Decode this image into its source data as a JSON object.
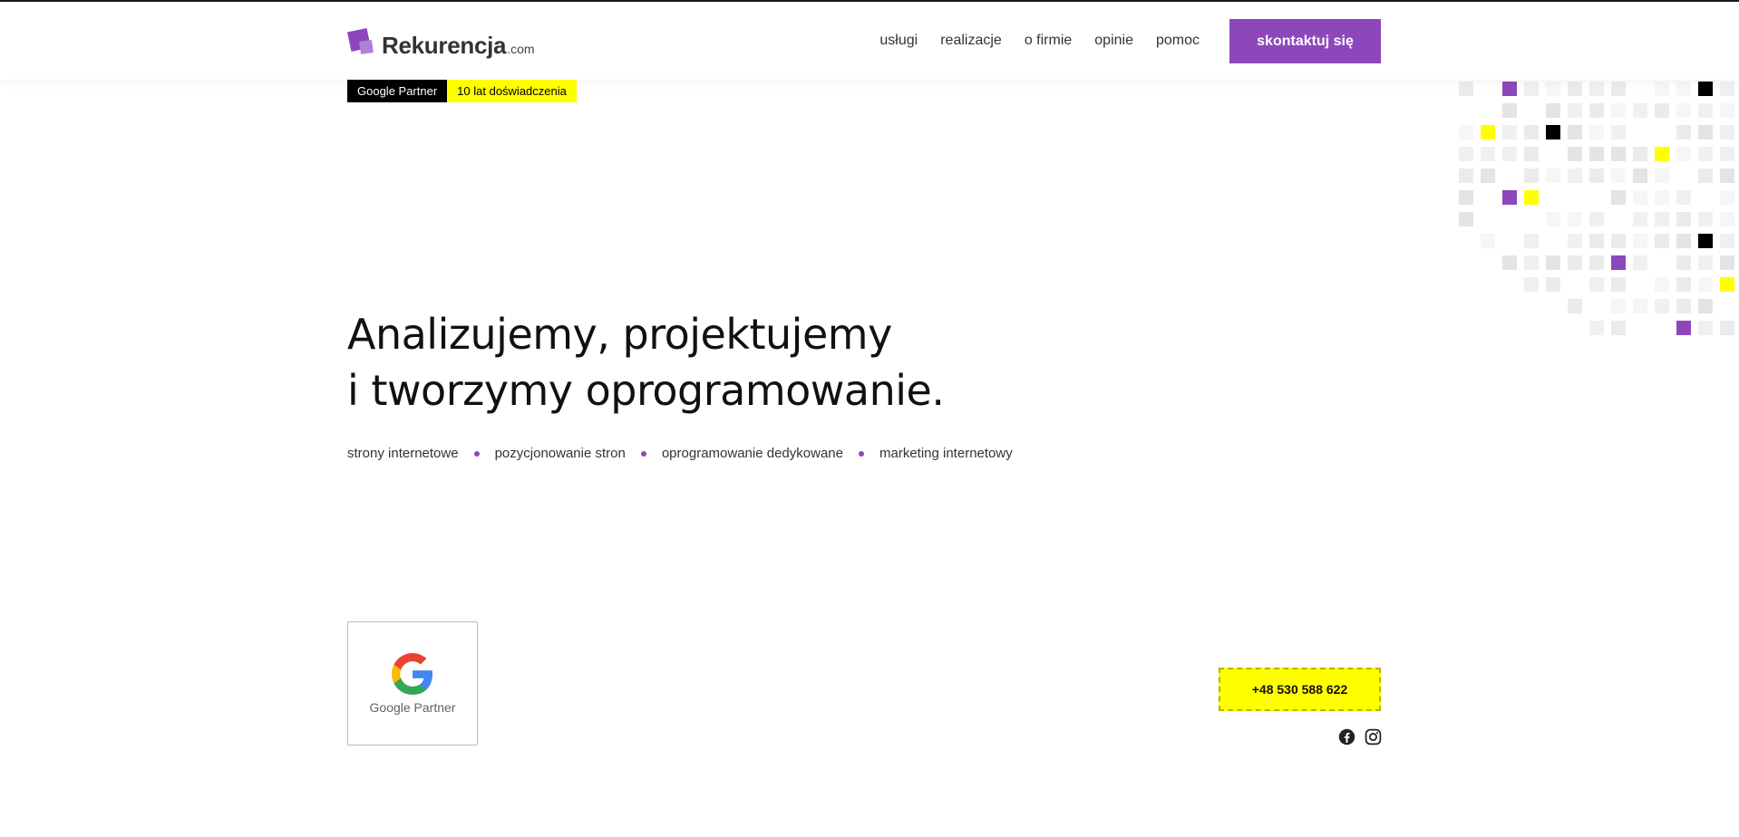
{
  "header": {
    "logo_name": "Rekurencja",
    "logo_tld": ".com",
    "nav": [
      {
        "label": "usługi"
      },
      {
        "label": "realizacje"
      },
      {
        "label": "o firmie"
      },
      {
        "label": "opinie"
      },
      {
        "label": "pomoc"
      }
    ],
    "cta_label": "skontaktuj się"
  },
  "badges": {
    "partner": "Google Partner",
    "experience": "10 lat doświadczenia"
  },
  "hero": {
    "title_line1": "Analizujemy, projektujemy",
    "title_line2": "i tworzymy oprogramowanie.",
    "services": [
      "strony internetowe",
      "pozycjonowanie stron",
      "oprogramowanie dedykowane",
      "marketing internetowy"
    ]
  },
  "google_partner_card": {
    "label": "Google Partner"
  },
  "contact": {
    "phone": "+48 530 588 622"
  },
  "social": [
    "facebook-icon",
    "instagram-icon"
  ],
  "colors": {
    "brand_purple": "#8d47bb",
    "accent_yellow": "#ffff00",
    "text_dark": "#111111"
  }
}
